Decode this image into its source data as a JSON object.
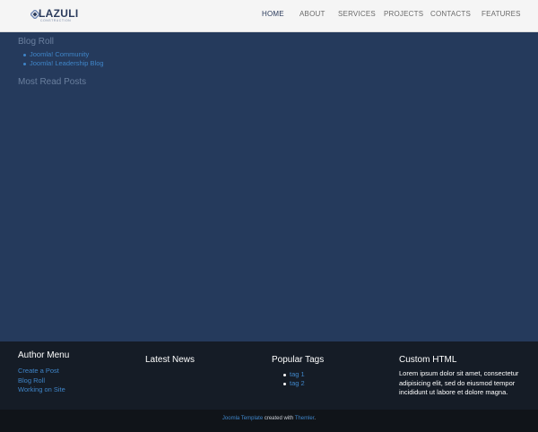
{
  "header": {
    "logo_text": "LAZULI",
    "logo_subtext": "CONSTRUCTION",
    "nav": [
      {
        "label": "HOME",
        "active": true
      },
      {
        "label": "ABOUT",
        "active": false
      },
      {
        "label": "SERVICES",
        "active": false
      },
      {
        "label": "PROJECTS",
        "active": false
      },
      {
        "label": "CONTACTS",
        "active": false
      },
      {
        "label": "FEATURES",
        "active": false
      }
    ]
  },
  "main": {
    "blog_roll": {
      "title": "Blog Roll",
      "links": [
        "Joomla! Community",
        "Joomla! Leadership Blog"
      ]
    },
    "most_read": {
      "title": "Most Read Posts"
    }
  },
  "footer": {
    "author_menu": {
      "title": "Author Menu",
      "links": [
        "Create a Post",
        "Blog Roll",
        "Working on Site"
      ]
    },
    "latest_news": {
      "title": "Latest News"
    },
    "popular_tags": {
      "title": "Popular Tags",
      "tags": [
        "tag 1",
        "tag 2"
      ]
    },
    "custom_html": {
      "title": "Custom HTML",
      "text": "Lorem ipsum dolor sit amet, consectetur adipisicing elit, sed do eiusmod tempor incididunt ut labore et dolore magna."
    }
  },
  "credits": {
    "link1": "Joomla Template",
    "middle": " created with ",
    "link2": "Themler",
    "end": "."
  },
  "colors": {
    "header_bg": "#f5f5f5",
    "main_bg": "#253a5c",
    "footer_bg": "#151c26",
    "bottom_bg": "#101419",
    "link": "#3f85c8",
    "brand": "#2b3b5c"
  }
}
